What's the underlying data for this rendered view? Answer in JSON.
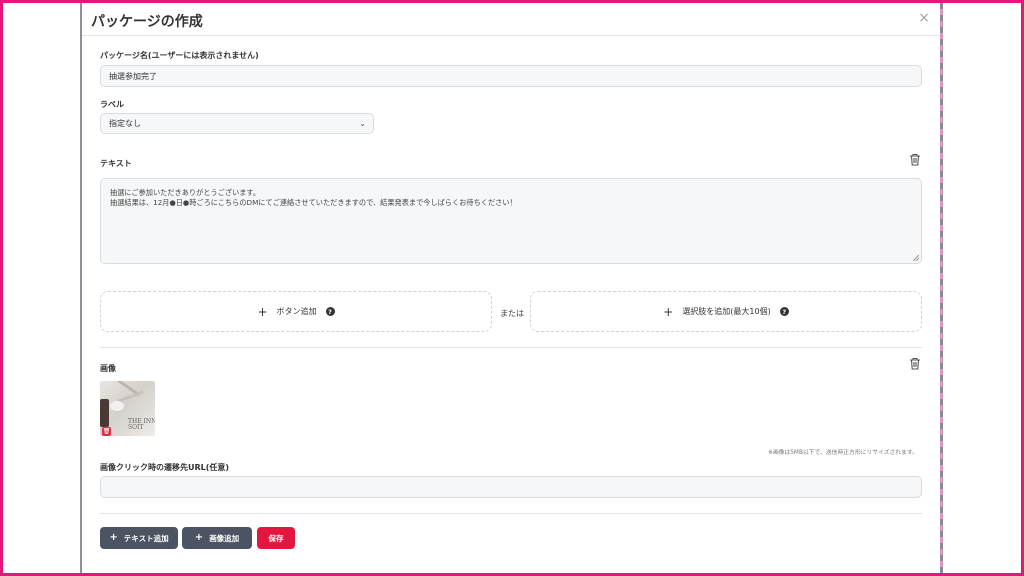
{
  "modal": {
    "title": "パッケージの作成",
    "close_label": "×"
  },
  "package_name": {
    "label": "パッケージ名(ユーザーには表示されません)",
    "value": "抽選参加完了"
  },
  "label_field": {
    "label": "ラベル",
    "selected": "指定なし"
  },
  "text_section": {
    "label": "テキスト",
    "line1": "抽選にご参加いただきありがとうございます。",
    "line2": "抽選結果は、12月●日●時ごろにこちらのDMにてご連絡させていただきますので、結果発表まで今しばらくお待ちください！"
  },
  "add_button_box": {
    "label": "ボタン追加"
  },
  "or_text": "または",
  "add_choice_box": {
    "label": "選択肢を追加(最大10個)"
  },
  "image_section": {
    "label": "画像",
    "thumb_text": "THE INN\nSOIT",
    "note": "※画像は5MB以下で、送信時正方形にリサイズされます。"
  },
  "image_url": {
    "label": "画像クリック時の遷移先URL(任意)",
    "value": ""
  },
  "footer": {
    "add_text": "テキスト追加",
    "add_image": "画像追加",
    "save": "保存"
  },
  "colors": {
    "frame": "#e6177a",
    "save": "#e3163f",
    "dark_button": "#4c5463"
  },
  "icons": {
    "trash": "trash-icon",
    "plus": "plus-icon",
    "help": "question-circle-icon",
    "chevron": "chevron-down-icon",
    "close": "close-icon"
  }
}
